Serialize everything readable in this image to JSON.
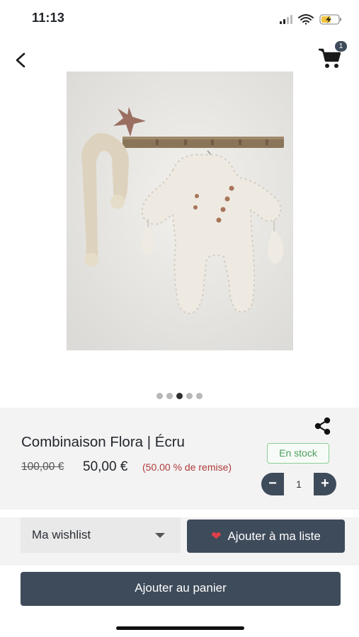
{
  "status_bar": {
    "time": "11:13"
  },
  "nav": {
    "cart_count": "1"
  },
  "gallery": {
    "dots": 5,
    "active_index": 2
  },
  "product": {
    "title": "Combinaison Flora | Écru",
    "old_price": "100,00 €",
    "new_price": "50,00 €",
    "discount": "(50.00 % de remise)",
    "stock": "En stock",
    "quantity": "1",
    "minus_label": "−",
    "plus_label": "+"
  },
  "wishlist": {
    "selected": "Ma wishlist",
    "add_label": "Ajouter à ma liste"
  },
  "cart": {
    "add_label": "Ajouter au panier"
  },
  "colors": {
    "primary": "#3e4b5a",
    "stock_green": "#4a9e5a",
    "discount_red": "#b03a3a",
    "heart": "#e0404a"
  },
  "icons": [
    "signal-icon",
    "wifi-icon",
    "battery-icon",
    "back-chevron-icon",
    "cart-icon",
    "share-icon",
    "heart-icon",
    "dropdown-caret-icon"
  ]
}
